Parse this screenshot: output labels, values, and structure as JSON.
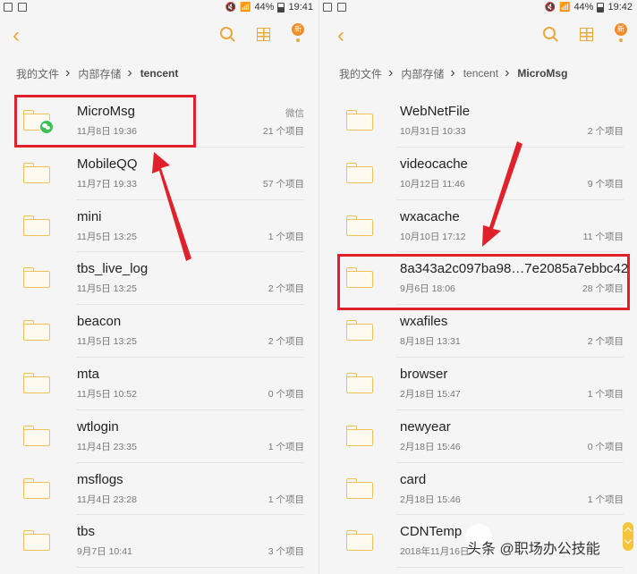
{
  "left_panel": {
    "status": {
      "battery_pct": "44%",
      "time": "19:41"
    },
    "breadcrumb": [
      "我的文件",
      "内部存储",
      "tencent"
    ],
    "more_badge": "新",
    "items": [
      {
        "name": "MicroMsg",
        "date": "11月8日 19:36",
        "tag": "微信",
        "count": "21 个项目"
      },
      {
        "name": "MobileQQ",
        "date": "11月7日 19:33",
        "tag": "",
        "count": "57 个项目"
      },
      {
        "name": "mini",
        "date": "11月5日 13:25",
        "tag": "",
        "count": "1 个项目"
      },
      {
        "name": "tbs_live_log",
        "date": "11月5日 13:25",
        "tag": "",
        "count": "2 个项目"
      },
      {
        "name": "beacon",
        "date": "11月5日 13:25",
        "tag": "",
        "count": "2 个项目"
      },
      {
        "name": "mta",
        "date": "11月5日 10:52",
        "tag": "",
        "count": "0 个项目"
      },
      {
        "name": "wtlogin",
        "date": "11月4日 23:35",
        "tag": "",
        "count": "1 个项目"
      },
      {
        "name": "msflogs",
        "date": "11月4日 23:28",
        "tag": "",
        "count": "1 个项目"
      },
      {
        "name": "tbs",
        "date": "9月7日 10:41",
        "tag": "",
        "count": "3 个项目"
      }
    ]
  },
  "right_panel": {
    "status": {
      "battery_pct": "44%",
      "time": "19:42"
    },
    "breadcrumb": [
      "我的文件",
      "内部存储",
      "tencent",
      "MicroMsg"
    ],
    "more_badge": "新",
    "items": [
      {
        "name": "WebNetFile",
        "date": "10月31日 10:33",
        "count": "2 个项目"
      },
      {
        "name": "videocache",
        "date": "10月12日 11:46",
        "count": "9 个项目"
      },
      {
        "name": "wxacache",
        "date": "10月10日 17:12",
        "count": "11 个项目"
      },
      {
        "name": "8a343a2c097ba98…7e2085a7ebbc42",
        "date": "9月6日 18:06",
        "count": "28 个项目"
      },
      {
        "name": "wxafiles",
        "date": "8月18日 13:31",
        "count": "2 个项目"
      },
      {
        "name": "browser",
        "date": "2月18日 15:47",
        "count": "1 个项目"
      },
      {
        "name": "newyear",
        "date": "2月18日 15:46",
        "count": "0 个项目"
      },
      {
        "name": "card",
        "date": "2月18日 15:46",
        "count": "1 个项目"
      },
      {
        "name": "CDNTemp",
        "date": "2018年11月16日",
        "count": ""
      }
    ]
  },
  "watermark": "头条 @职场办公技能",
  "colors": {
    "accent": "#e8a83a",
    "highlight": "#e0202a",
    "wechat": "#3cc155"
  }
}
